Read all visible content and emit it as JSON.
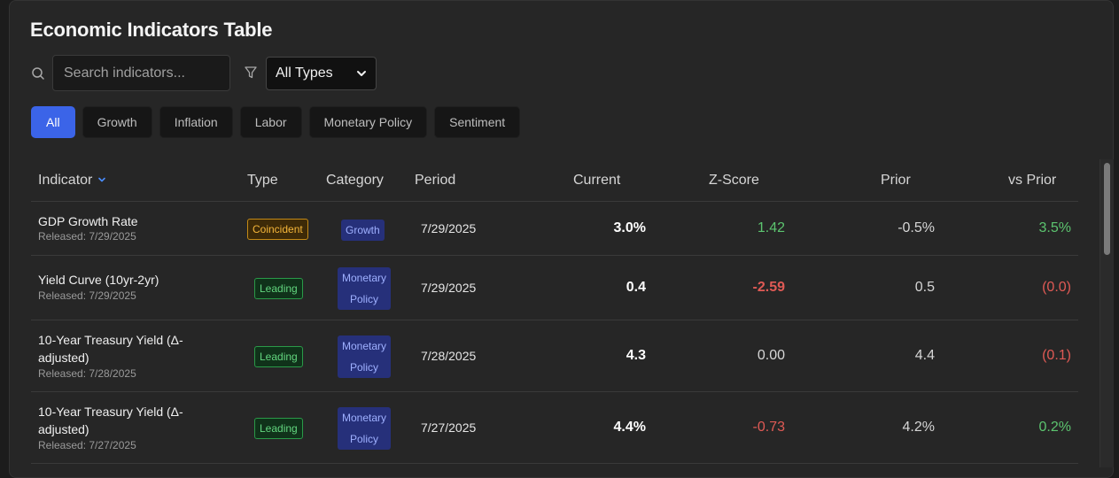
{
  "title": "Economic Indicators Table",
  "search": {
    "placeholder": "Search indicators..."
  },
  "type_filter": {
    "selected": "All Types"
  },
  "chips": [
    "All",
    "Growth",
    "Inflation",
    "Labor",
    "Monetary Policy",
    "Sentiment"
  ],
  "columns": [
    "Indicator",
    "Type",
    "Category",
    "Period",
    "Current",
    "Z-Score",
    "Prior",
    "vs Prior"
  ],
  "rows": [
    {
      "name": "GDP Growth Rate",
      "released": "Released: 7/29/2025",
      "type": "Coincident",
      "category": "Growth",
      "period": "7/29/2025",
      "current": "3.0%",
      "zscore": "1.42",
      "prior": "-0.5%",
      "vs_prior": "3.5%"
    },
    {
      "name": "Yield Curve (10yr-2yr)",
      "released": "Released: 7/29/2025",
      "type": "Leading",
      "category_line1": "Monetary",
      "category_line2": "Policy",
      "period": "7/29/2025",
      "current": "0.4",
      "zscore": "-2.59",
      "prior": "0.5",
      "vs_prior": "(0.0)"
    },
    {
      "name_line1": "10-Year Treasury Yield (Δ-",
      "name_line2": "adjusted)",
      "released": "Released: 7/28/2025",
      "type": "Leading",
      "category_line1": "Monetary",
      "category_line2": "Policy",
      "period": "7/28/2025",
      "current": "4.3",
      "zscore": "0.00",
      "prior": "4.4",
      "vs_prior": "(0.1)"
    },
    {
      "name_line1": "10-Year Treasury Yield (Δ-",
      "name_line2": "adjusted)",
      "released": "Released: 7/27/2025",
      "type": "Leading",
      "category_line1": "Monetary",
      "category_line2": "Policy",
      "period": "7/27/2025",
      "current": "4.4%",
      "zscore": "-0.73",
      "prior": "4.2%",
      "vs_prior": "0.2%"
    }
  ]
}
